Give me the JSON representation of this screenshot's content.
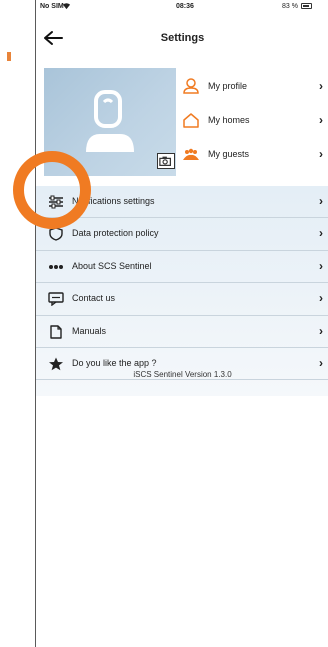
{
  "status_bar": {
    "carrier": "No SIM",
    "time": "08:36",
    "battery": "83 %"
  },
  "header": {
    "title": "Settings",
    "back_icon": "arrow-left-icon"
  },
  "profile": {
    "avatar_icon": "user-placeholder-icon",
    "camera_icon": "camera-icon",
    "items": [
      {
        "label": "My profile",
        "icon": "person-icon",
        "color": "#f07b22"
      },
      {
        "label": "My homes",
        "icon": "home-icon",
        "color": "#f07b22"
      },
      {
        "label": "My guests",
        "icon": "group-icon",
        "color": "#f07b22"
      }
    ]
  },
  "settings": {
    "items": [
      {
        "label": "Notifications settings",
        "icon": "sliders-icon"
      },
      {
        "label": "Data protection policy",
        "icon": "shield-icon"
      },
      {
        "label": "About SCS Sentinel",
        "icon": "dots-icon"
      },
      {
        "label": "Contact us",
        "icon": "chat-icon"
      },
      {
        "label": "Manuals",
        "icon": "document-icon"
      },
      {
        "label": "Do you like the app ?",
        "icon": "star-icon"
      }
    ],
    "version": "iSCS Sentinel Version 1.3.0"
  },
  "colors": {
    "accent": "#f07b22",
    "panel": "#e4eef6",
    "avatar_bg": "#b4cbdd"
  }
}
